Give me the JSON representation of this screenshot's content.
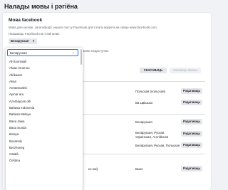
{
  "page": {
    "title": "Налады мовы і рэгіёна"
  },
  "facebook_language": {
    "section_title": "Мова facebook",
    "description": "Мова для кнопак, загалоўкаў і іншага тэксту Facebook для гэтага акаўнта на сайце www.facebook.com.",
    "show_label": "Паказваць Facebook на гэтай мове.",
    "selected_value": "Беларуская",
    "extra_label": "эчай мове недаступны."
  },
  "buttons": {
    "cancel": "СКАСАВАЦЬ",
    "save": "Захаваць змены",
    "edit": "Рэдагаваць"
  },
  "rows": [
    {
      "value_lines": [
        "Польскaя (польская)"
      ]
    },
    {
      "value_lines": [
        "Ва Цвішыко"
      ]
    },
    {
      "value_lines": [
        "Беларуская"
      ]
    },
    {
      "value_lines": [
        "Беларуская, Руская,",
        "Украінская, Англійская"
      ]
    },
    {
      "value_lines": [
        "Беларуская, Руская, Польская"
      ]
    },
    {
      "value_lines": [
        "Выкл"
      ]
    }
  ],
  "footer_text": "ех мoў",
  "dropdown": {
    "selected": "Беларуская",
    "options": [
      "Af-Soomaali",
      "Afaan Oromoo",
      "Afrikaans",
      "Akan",
      "Armāneashti",
      "Aymar aru",
      "Azərbaycan dili",
      "Bahasa Indonesia",
      "Bahasa Melayu",
      "Basa Jawa",
      "Basa Sunda",
      "Bisaya",
      "Bosanski",
      "Brezhoneg",
      "Català",
      "Čeština"
    ]
  }
}
